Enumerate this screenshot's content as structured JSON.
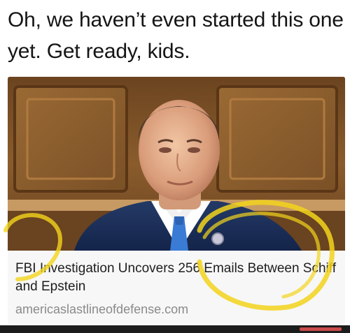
{
  "post": {
    "caption": "Oh, we haven’t even started this one yet. Get ready, kids."
  },
  "link_card": {
    "title": "FBI Investigation Uncovers 256 Emails Between Schiff and Epstein",
    "domain": "americaslastlineofdefense.com"
  },
  "colors": {
    "highlight": "#f2d41c",
    "card_background": "#f7f7f7",
    "wood_panel": "#7a4f24"
  }
}
